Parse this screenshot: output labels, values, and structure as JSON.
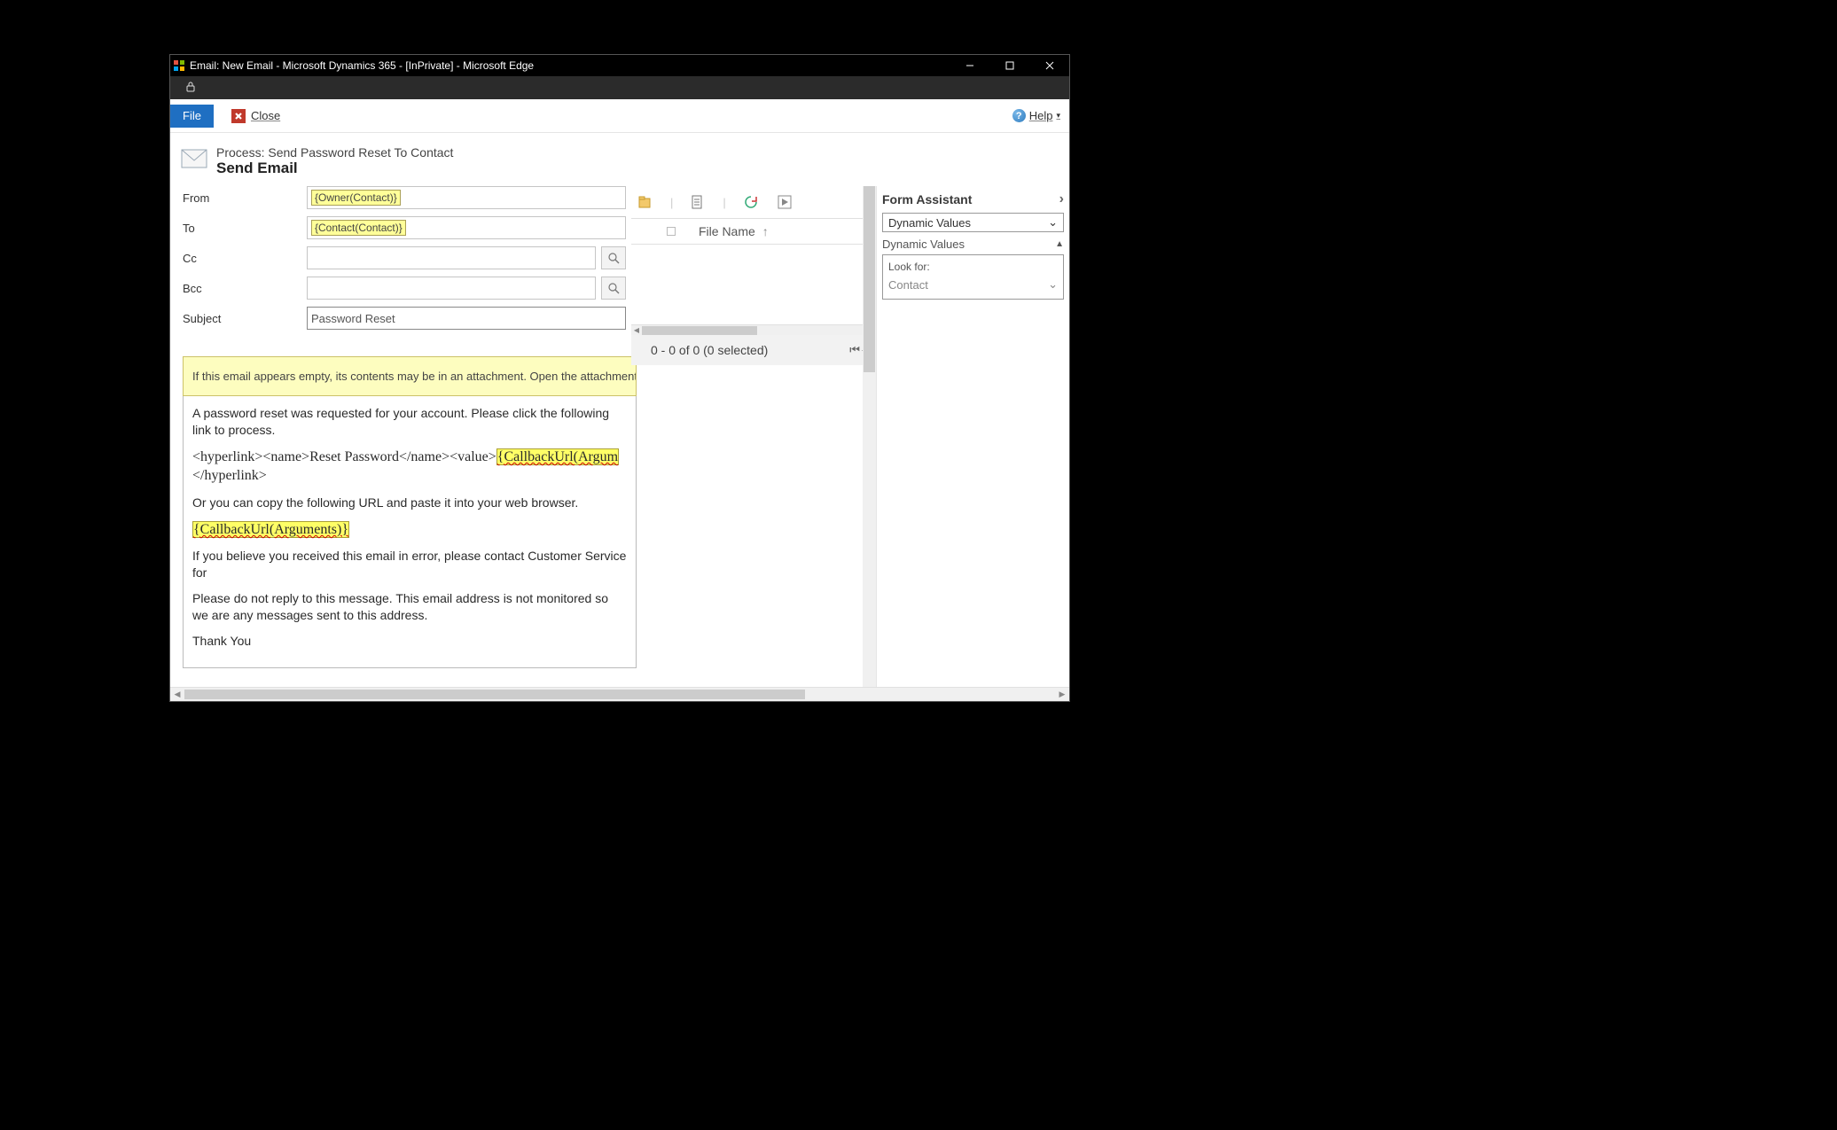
{
  "window": {
    "title": "Email: New Email - Microsoft Dynamics 365 - [InPrivate] - Microsoft Edge"
  },
  "menubar": {
    "file_label": "File",
    "close_label": "Close",
    "help_label": "Help"
  },
  "header": {
    "process": "Process: Send Password Reset To Contact",
    "action": "Send Email"
  },
  "fields": {
    "from_label": "From",
    "from_value": "{Owner(Contact)}",
    "to_label": "To",
    "to_value": "{Contact(Contact)}",
    "cc_label": "Cc",
    "bcc_label": "Bcc",
    "subject_label": "Subject",
    "subject_value": "Password Reset"
  },
  "attachments": {
    "header_label": "File Name",
    "footer_text": "0 - 0 of 0 (0 selected)"
  },
  "notice": "If this email appears empty, its contents may be in an attachment. Open the attachment to view the",
  "body": {
    "p1": "A password reset was requested for your account. Please click the following link to process.",
    "hyper_pre": "<hyperlink><name>Reset Password</name><value>",
    "hyper_token": "{CallbackUrl(Argum",
    "hyper_post": "</hyperlink>",
    "p3": "Or you can copy the following URL and paste it into your web browser.",
    "token2": "{CallbackUrl(Arguments)}",
    "p5": "If you believe you received this email in error, please contact Customer Service for",
    "p6": "Please do not reply to this message. This email address is not monitored so we are any messages sent to this address.",
    "p7": "Thank You"
  },
  "assistant": {
    "title": "Form Assistant",
    "select_value": "Dynamic Values",
    "subhead": "Dynamic Values",
    "lookfor_label": "Look for:",
    "lookfor_value": "Contact"
  }
}
